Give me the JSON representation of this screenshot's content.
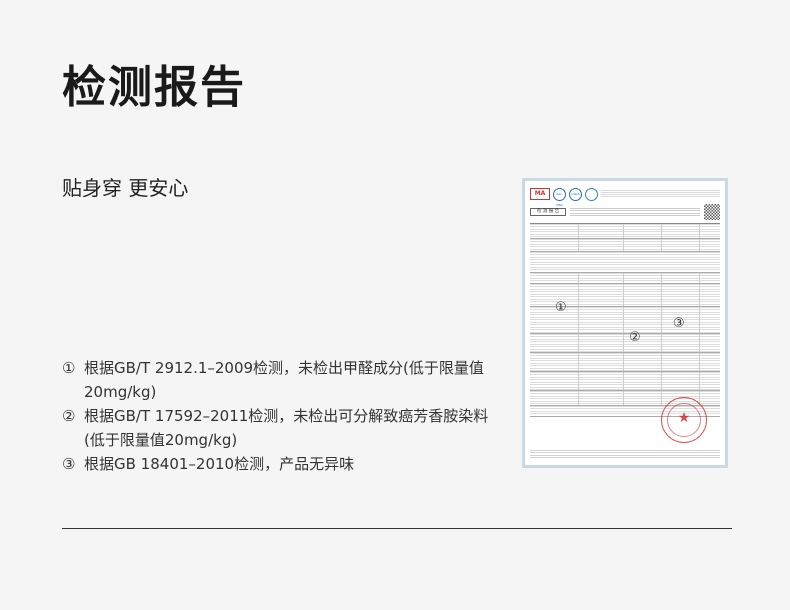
{
  "title": "检测报告",
  "subtitle": "贴身穿 更安心",
  "notes": [
    {
      "num": "①",
      "text": "根据GB/T 2912.1–2009检测，未检出甲醛成分(低于限量值20mg/kg)"
    },
    {
      "num": "②",
      "text": "根据GB/T 17592–2011检测，未检出可分解致癌芳香胺染料(低于限量值20mg/kg)"
    },
    {
      "num": "③",
      "text": "根据GB 18401–2010检测，产品无异味"
    }
  ],
  "report": {
    "heading": "检 测 报 告",
    "marks": [
      "①",
      "②",
      "③"
    ],
    "logos": [
      "MA",
      "ilac-MRA",
      "CNAS"
    ]
  }
}
